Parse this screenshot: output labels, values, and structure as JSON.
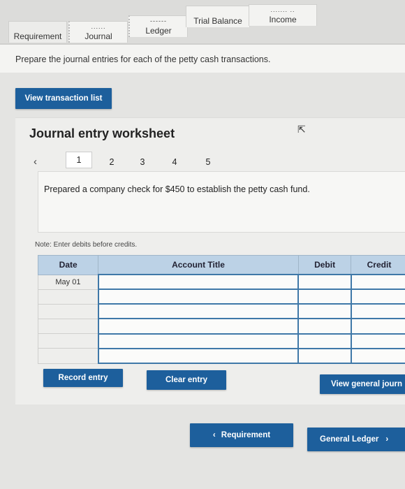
{
  "tabs": [
    {
      "label": "Requirement",
      "dash": ""
    },
    {
      "label": "Journal",
      "dash": "......"
    },
    {
      "label": "Ledger",
      "dash": "------"
    },
    {
      "label": "Trial Balance",
      "dash": ""
    },
    {
      "label": "Income",
      "dash": "....... .."
    }
  ],
  "prompt": "Prepare the journal entries for each of the petty cash transactions.",
  "buttons": {
    "view_transaction_list": "View transaction list",
    "record_entry": "Record entry",
    "clear_entry": "Clear entry",
    "view_general_journal": "View general journ",
    "nav_prev": "Requirement",
    "nav_next": "General Ledger"
  },
  "worksheet": {
    "title": "Journal entry worksheet",
    "steps": [
      "1",
      "2",
      "3",
      "4",
      "5"
    ],
    "active_step": "1",
    "description": "Prepared a company check for $450 to establish the petty cash fund.",
    "note": "Note: Enter debits before credits."
  },
  "table": {
    "headers": [
      "Date",
      "Account Title",
      "Debit",
      "Credit"
    ],
    "rows": [
      {
        "date": "May 01",
        "account": "",
        "debit": "",
        "credit": ""
      },
      {
        "date": "",
        "account": "",
        "debit": "",
        "credit": ""
      },
      {
        "date": "",
        "account": "",
        "debit": "",
        "credit": ""
      },
      {
        "date": "",
        "account": "",
        "debit": "",
        "credit": ""
      },
      {
        "date": "",
        "account": "",
        "debit": "",
        "credit": ""
      },
      {
        "date": "",
        "account": "",
        "debit": "",
        "credit": ""
      }
    ]
  },
  "colors": {
    "button_blue": "#1d5f9c",
    "table_header": "#bcd2e6",
    "cell_border": "#3f78a8"
  }
}
